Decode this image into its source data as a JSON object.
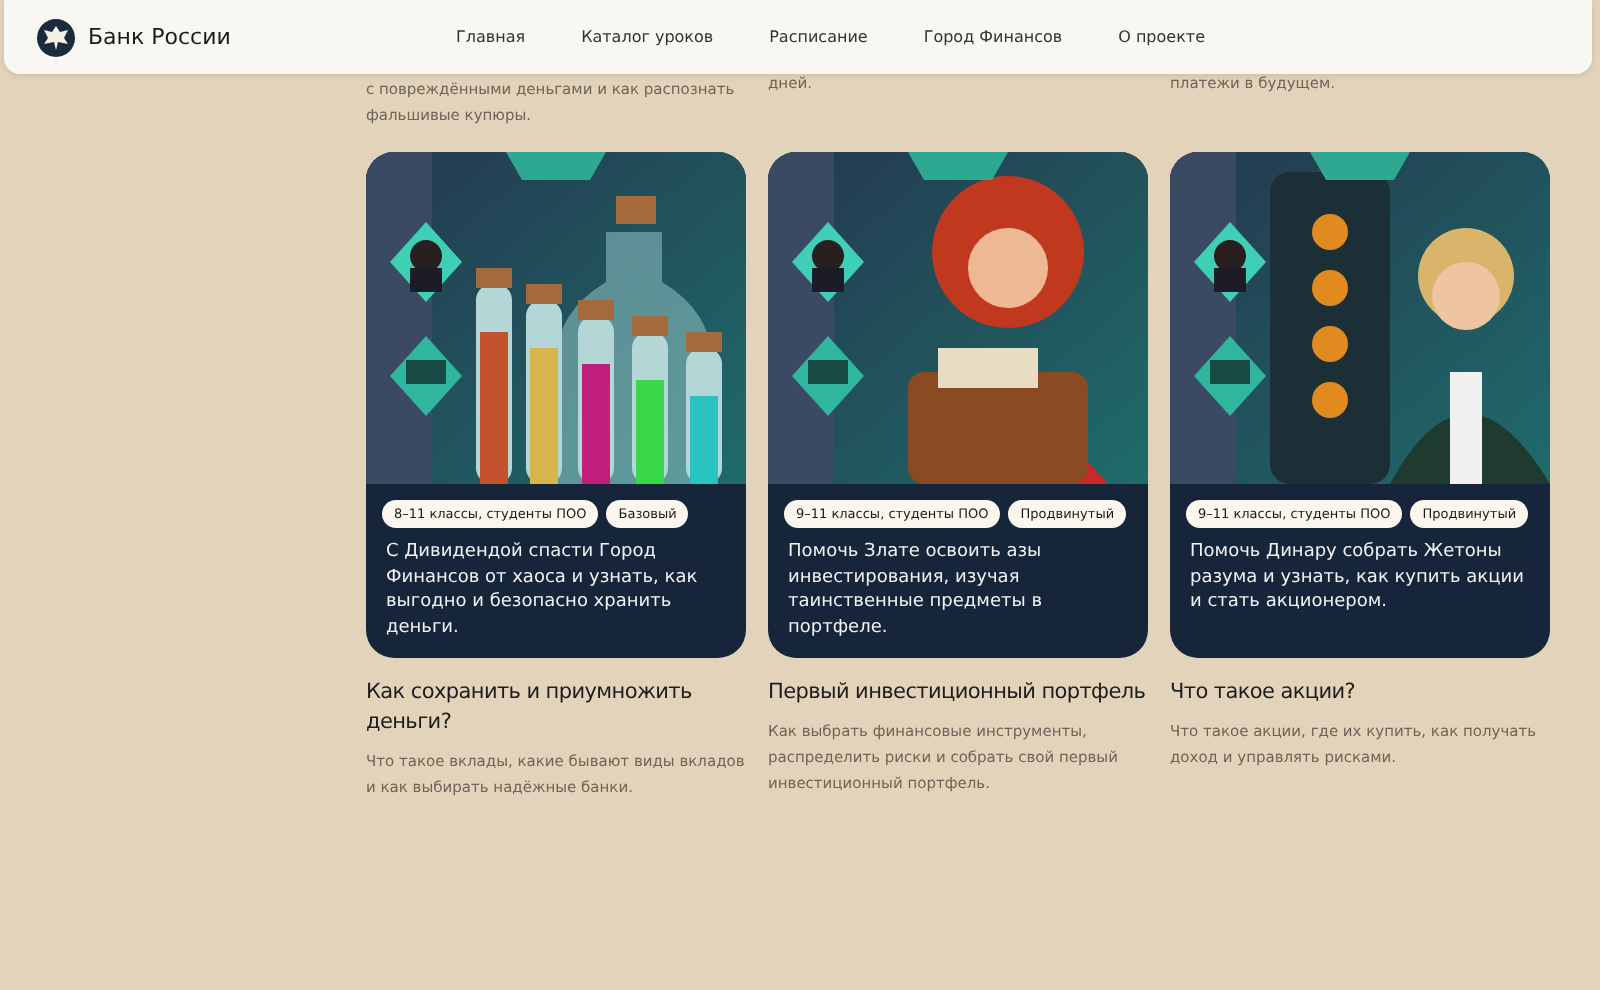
{
  "header": {
    "logo_text": "Банк России",
    "nav": [
      {
        "label": "Главная"
      },
      {
        "label": "Каталог уроков"
      },
      {
        "label": "Расписание"
      },
      {
        "label": "Город Финансов"
      },
      {
        "label": "О проекте"
      }
    ]
  },
  "previous_row": [
    {
      "lines": [
        "с повреждёнными деньгами и как распознать",
        "фальшивые купюры."
      ]
    },
    {
      "lines": [
        "дней."
      ]
    },
    {
      "lines": [
        "платежи в будущем."
      ]
    }
  ],
  "lessons": [
    {
      "kind": "picture",
      "tags": [
        {
          "label": "8–11 классы, студенты ПОО"
        },
        {
          "label": "Базовый"
        }
      ],
      "card_text": "С Дивидендой спасти Город Финансов от хаоса и узнать, как выгодно и безопасно хранить деньги.",
      "title": "Как сохранить и приумножить деньги?",
      "description": "Что такое вклады, какие бывают виды вкладов и как выбирать надёжные банки."
    },
    {
      "kind": "picture",
      "tags": [
        {
          "label": "9–11 классы, студенты ПОО"
        },
        {
          "label": "Продвинутый"
        }
      ],
      "card_text": "Помочь Злате освоить азы инвестирования, изучая таинственные предметы в портфеле.",
      "title": "Первый инвестиционный портфель",
      "description": "Как выбрать финансовые инструменты, распределить риски и собрать свой первый инвестиционный портфель."
    },
    {
      "kind": "picture",
      "tags": [
        {
          "label": "9–11 классы, студенты ПОО"
        },
        {
          "label": "Продвинутый"
        }
      ],
      "card_text": "Помочь Динару собрать Жетоны разума и узнать, как купить акции и стать акционером.",
      "title": "Что такое акции?",
      "description": "Что такое акции, где их купить, как получать доход и управлять рисками."
    }
  ]
}
